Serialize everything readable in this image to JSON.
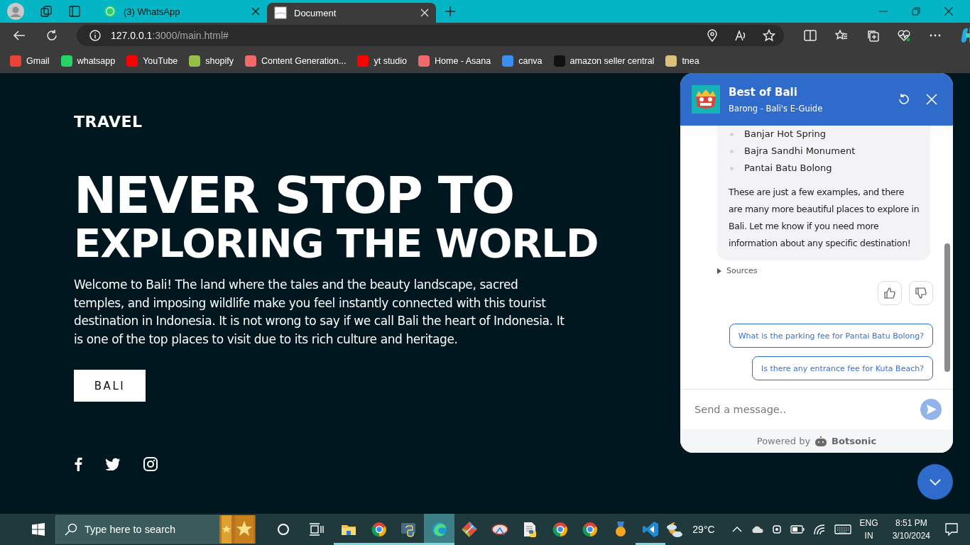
{
  "browser": {
    "tabs": [
      {
        "title": "(3) WhatsApp",
        "selected": false
      },
      {
        "title": "Document",
        "selected": true
      }
    ],
    "address": {
      "host": "127.0.0.1",
      "path": ":3000/main.html#"
    },
    "bookmarks": [
      {
        "label": "Gmail",
        "color": "#ea4335"
      },
      {
        "label": "whatsapp",
        "color": "#25d366"
      },
      {
        "label": "YouTube",
        "color": "#ff0000"
      },
      {
        "label": "shopify",
        "color": "#95bf47"
      },
      {
        "label": "Content Generation...",
        "color": "#f06a6a"
      },
      {
        "label": "yt studio",
        "color": "#ff0000"
      },
      {
        "label": "Home - Asana",
        "color": "#f06a6a"
      },
      {
        "label": "canva",
        "color": "#3a8ff5"
      },
      {
        "label": "amazon seller central",
        "color": "#111111"
      },
      {
        "label": "tnea",
        "color": "#d9c27a"
      }
    ]
  },
  "page": {
    "brand": "TRAVEL",
    "heading": [
      "NEVER STOP TO",
      "EXPLORING THE WORLD"
    ],
    "intro": "Welcome to Bali! The land where the tales and the beauty landscape, sacred temples, and imposing wildlife make you feel instantly connected with this tourist destination in Indonesia. It is not wrong to say if we call Bali the heart of Indonesia. It is one of the top places to visit due to its rich culture and heritage.",
    "button": "BALI"
  },
  "chat": {
    "title": "Best of Bali",
    "subtitle": "Barong - Bali's E-Guide",
    "list_items": [
      "Banjar Hot Spring",
      "Bajra Sandhi Monument",
      "Pantai Batu Bolong"
    ],
    "message": "These are just a few examples, and there are many more beautiful places to explore in Bali. Let me know if you need more information about any specific destination!",
    "sources": "Sources",
    "suggestions": [
      "What is the parking fee for Pantai Batu Bolong?",
      "Is there any entrance fee for Kuta Beach?"
    ],
    "input": {
      "placeholder": "Send a message.."
    },
    "powered_by": "Powered by",
    "provider": "Botsonic"
  },
  "taskbar": {
    "search": {
      "placeholder": "Type here to search"
    },
    "apps": [
      {
        "kind": "folder",
        "running": true,
        "selected": false
      },
      {
        "kind": "ring",
        "running": true,
        "selected": false
      },
      {
        "kind": "snake",
        "running": true,
        "selected": false
      },
      {
        "kind": "wave",
        "running": true,
        "selected": true
      },
      {
        "kind": "diamond",
        "running": false,
        "selected": false
      },
      {
        "kind": "saucer",
        "running": false,
        "selected": false
      },
      {
        "kind": "document",
        "running": false,
        "selected": false
      },
      {
        "kind": "ring",
        "running": false,
        "selected": false
      },
      {
        "kind": "ring",
        "running": false,
        "selected": false
      },
      {
        "kind": "medal",
        "running": false,
        "selected": false
      },
      {
        "kind": "code",
        "running": true,
        "selected": false
      }
    ],
    "temperature": "29°C",
    "language": [
      "ENG",
      "IN"
    ],
    "time": "8:51 PM",
    "date": "3/10/2024"
  }
}
